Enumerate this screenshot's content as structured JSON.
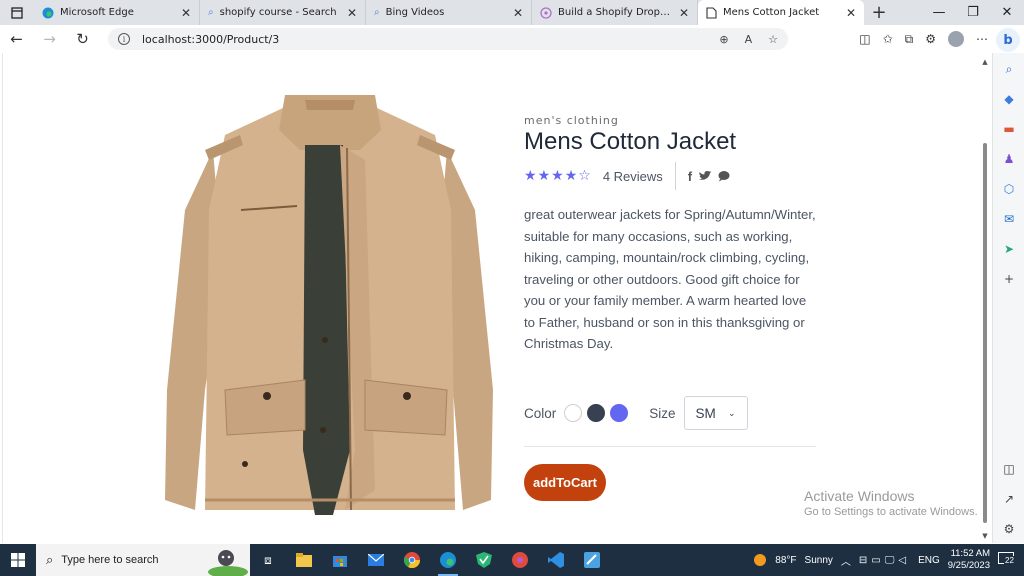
{
  "tabs": [
    {
      "label": "Microsoft Edge",
      "icon": "edge-icon",
      "active": false
    },
    {
      "label": "shopify course - Search",
      "icon": "search-icon",
      "active": false
    },
    {
      "label": "Bing Videos",
      "icon": "search-icon",
      "active": false
    },
    {
      "label": "Build a Shopify Dropshipping",
      "icon": "shopify-icon",
      "active": false
    },
    {
      "label": "Mens Cotton Jacket",
      "icon": "page-icon",
      "active": true
    }
  ],
  "address": {
    "url": "localhost:3000/Product/3"
  },
  "product": {
    "category": "men's clothing",
    "title": "Mens Cotton Jacket",
    "rating": 4,
    "rating_max": 5,
    "reviews": "4 Reviews",
    "description": "great outerwear jackets for Spring/Autumn/Winter, suitable for many occasions, such as working, hiking, camping, mountain/rock climbing, cycling, traveling or other outdoors. Good gift choice for you or your family member. A warm hearted love to Father, husband or son in this thanksgiving or Christmas Day.",
    "color_label": "Color",
    "colors": [
      "#ffffff",
      "#374151",
      "#6366f1"
    ],
    "size_label": "Size",
    "size_value": "SM",
    "cart_label": "addToCart",
    "accent": "#c2410c"
  },
  "watermark": {
    "line1": "Activate Windows",
    "line2": "Go to Settings to activate Windows."
  },
  "taskbar": {
    "search_placeholder": "Type here to search",
    "weather_temp": "88°F",
    "weather_cond": "Sunny",
    "lang": "ENG",
    "time": "11:52 AM",
    "date": "9/25/2023",
    "notifications": "22"
  }
}
